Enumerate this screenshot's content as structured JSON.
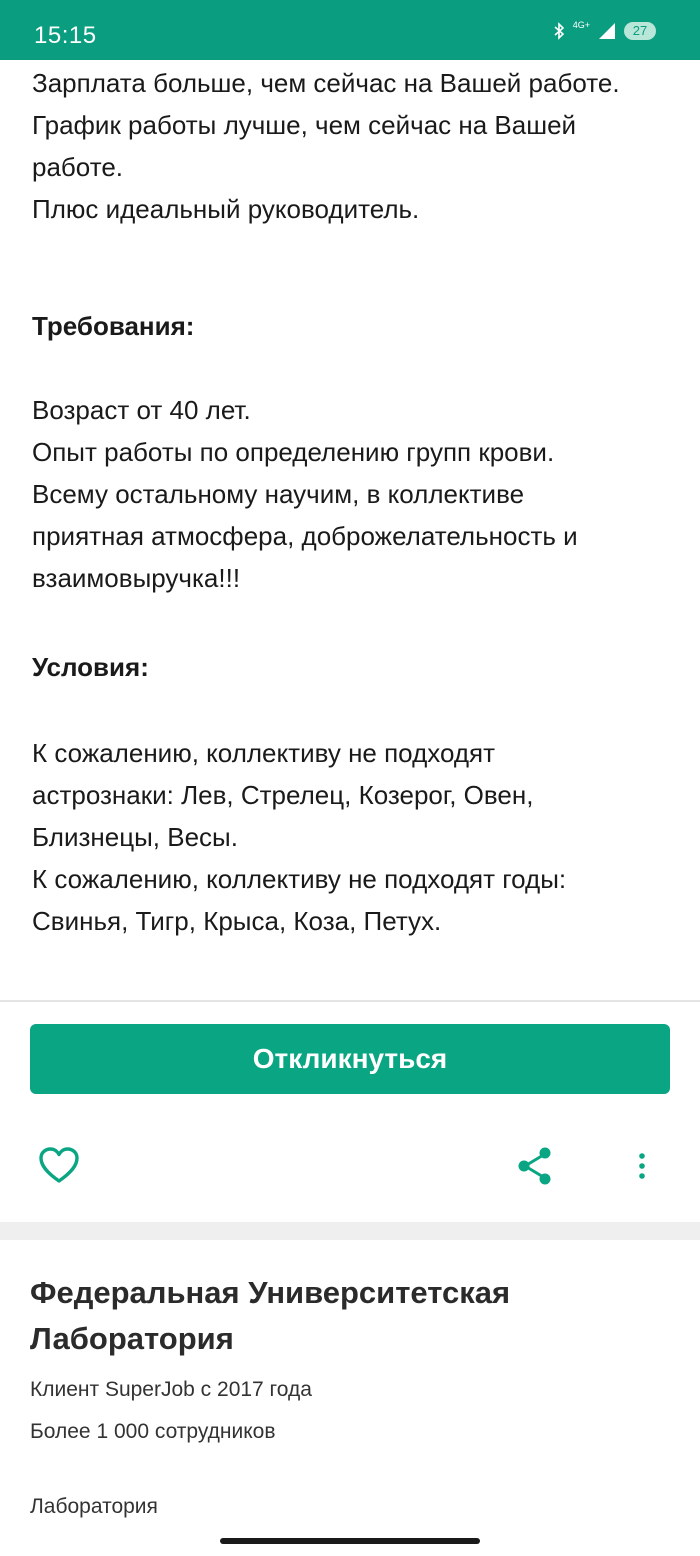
{
  "status_bar": {
    "time": "15:15",
    "network": "4G+",
    "battery": "27"
  },
  "description": {
    "intro_lines": [
      "Зарплата больше, чем сейчас на Вашей работе.",
      "График работы лучше, чем сейчас на Вашей",
      "работе.",
      "Плюс идеальный руководитель."
    ],
    "requirements_heading": "Требования:",
    "requirements_lines": [
      "Возраст от 40 лет.",
      "Опыт работы по определению групп крови.",
      "Всему остальному научим, в коллективе",
      "приятная атмосфера, доброжелательность и",
      "взаимовыручка!!!"
    ],
    "conditions_heading": "Условия:",
    "conditions_lines": [
      "К сожалению, коллективу не подходят",
      "астрознаки: Лев, Стрелец, Козерог, Овен,",
      "Близнецы, Весы.",
      "К сожалению, коллективу не подходят годы:",
      "Свинья, Тигр, Крыса, Коза, Петух."
    ]
  },
  "actions": {
    "apply_label": "Откликнуться",
    "favorite_icon": "heart-outline",
    "share_icon": "share",
    "more_icon": "more-vertical"
  },
  "company": {
    "name_line1": "Федеральная Университетская",
    "name_line2": "Лаборатория",
    "client_since": "Клиент SuperJob с 2017 года",
    "employees": "Более 1 000 сотрудников",
    "industry": "Лаборатория"
  },
  "colors": {
    "brand_green": "#0aa582",
    "status_bar": "#0a9d7f"
  }
}
